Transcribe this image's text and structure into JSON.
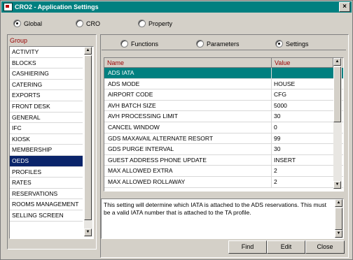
{
  "window": {
    "title": "CRO2 - Application Settings",
    "close_glyph": "×"
  },
  "scope": {
    "options": [
      {
        "label": "Global",
        "selected": true
      },
      {
        "label": "CRO",
        "selected": false
      },
      {
        "label": "Property",
        "selected": false
      }
    ]
  },
  "group": {
    "title": "Group",
    "items": [
      {
        "label": "ACTIVITY",
        "selected": false
      },
      {
        "label": "BLOCKS",
        "selected": false
      },
      {
        "label": "CASHIERING",
        "selected": false
      },
      {
        "label": "CATERING",
        "selected": false
      },
      {
        "label": "EXPORTS",
        "selected": false
      },
      {
        "label": "FRONT DESK",
        "selected": false
      },
      {
        "label": "GENERAL",
        "selected": false
      },
      {
        "label": "IFC",
        "selected": false
      },
      {
        "label": "KIOSK",
        "selected": false
      },
      {
        "label": "MEMBERSHIP",
        "selected": false
      },
      {
        "label": "OEDS",
        "selected": true
      },
      {
        "label": "PROFILES",
        "selected": false
      },
      {
        "label": "RATES",
        "selected": false
      },
      {
        "label": "RESERVATIONS",
        "selected": false
      },
      {
        "label": "ROOMS MANAGEMENT",
        "selected": false
      },
      {
        "label": "SELLING SCREEN",
        "selected": false
      }
    ]
  },
  "tabs": {
    "options": [
      {
        "label": "Functions",
        "selected": false
      },
      {
        "label": "Parameters",
        "selected": false
      },
      {
        "label": "Settings",
        "selected": true
      }
    ]
  },
  "table": {
    "headers": {
      "name": "Name",
      "value": "Value"
    },
    "rows": [
      {
        "name": "ADS IATA",
        "value": "",
        "selected": true
      },
      {
        "name": "ADS MODE",
        "value": "HOUSE"
      },
      {
        "name": "AIRPORT CODE",
        "value": "CFG"
      },
      {
        "name": "AVH BATCH SIZE",
        "value": "5000"
      },
      {
        "name": "AVH PROCESSING LIMIT",
        "value": "30"
      },
      {
        "name": "CANCEL WINDOW",
        "value": "0"
      },
      {
        "name": "GDS MAXAVAIL ALTERNATE RESORT",
        "value": "99"
      },
      {
        "name": "GDS PURGE INTERVAL",
        "value": "30"
      },
      {
        "name": "GUEST ADDRESS PHONE UPDATE",
        "value": "INSERT"
      },
      {
        "name": "MAX ALLOWED EXTRA",
        "value": "2"
      },
      {
        "name": "MAX ALLOWED ROLLAWAY",
        "value": "2"
      }
    ]
  },
  "description": "This setting will determine which IATA is attached to the ADS reservations. This must be a valid IATA number that is attached to the TA profile.",
  "buttons": {
    "find": "Find",
    "edit": "Edit",
    "close": "Close"
  },
  "scroll_arrows": {
    "up": "▲",
    "down": "▼"
  },
  "colors": {
    "title_bar": "#008080",
    "selected_group": "#0a246a",
    "selected_row": "#008080",
    "header_text": "#990000"
  }
}
